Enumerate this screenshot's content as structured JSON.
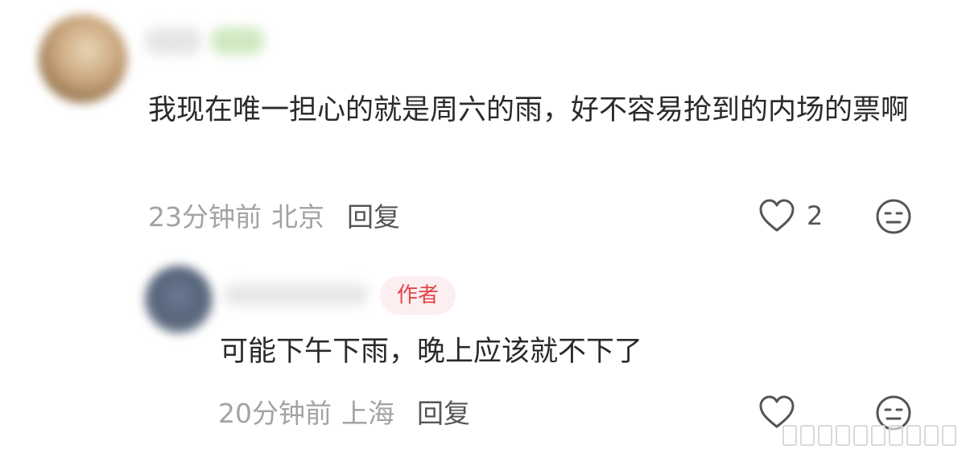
{
  "comments": [
    {
      "text": "我现在唯一担心的就是周六的雨，好不容易抢到的内场的票啊",
      "time": "23分钟前",
      "location": "北京",
      "reply_label": "回复",
      "like_count": "2",
      "like_icon": "heart-outline-icon",
      "dislike_icon": "unhappy-face-icon"
    },
    {
      "badge": "作者",
      "text": "可能下午下雨，晚上应该就不下了",
      "time": "20分钟前",
      "location": "上海",
      "reply_label": "回复",
      "like_icon": "heart-outline-icon",
      "dislike_icon": "unhappy-face-icon"
    }
  ],
  "colors": {
    "badge_text": "#e4434a",
    "badge_bg": "#fdeff0",
    "meta_gray": "#a3a3a3",
    "icon_gray": "#555555"
  }
}
